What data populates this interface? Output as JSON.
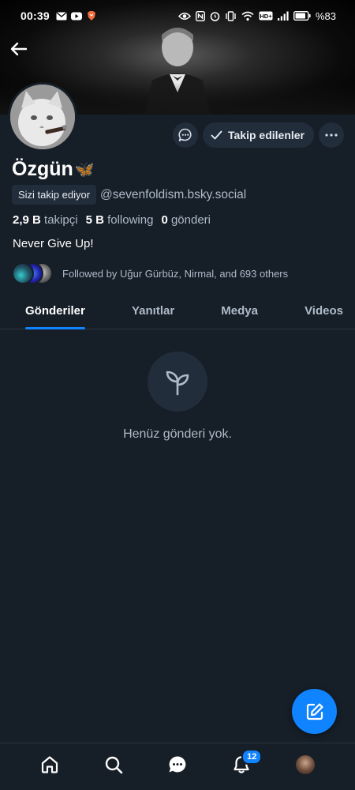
{
  "status_bar": {
    "time": "00:39",
    "battery_text": "%83",
    "network_badge": "HD+"
  },
  "profile": {
    "display_name": "Özgün",
    "name_emoji": "🦋",
    "follows_you_label": "Sizi takip ediyor",
    "handle": "@sevenfoldism.bsky.social",
    "followers_count": "2,9 B",
    "followers_label": "takipçi",
    "following_count": "5 B",
    "following_label": "following",
    "posts_count": "0",
    "posts_label": "gönderi",
    "bio": "Never Give Up!",
    "followed_by_text": "Followed by Uğur Gürbüz, Nirmal, and 693 others"
  },
  "actions": {
    "following_button_label": "Takip edilenler"
  },
  "tabs": [
    {
      "label": "Gönderiler",
      "active": true
    },
    {
      "label": "Yanıtlar",
      "active": false
    },
    {
      "label": "Medya",
      "active": false
    },
    {
      "label": "Videos",
      "active": false
    }
  ],
  "empty_state": {
    "message": "Henüz gönderi yok."
  },
  "bottom_nav": {
    "notifications_badge": "12"
  },
  "colors": {
    "background": "#161e27",
    "accent": "#1083fe",
    "secondary_text": "#aebbc9",
    "button_bg": "#222d3b"
  }
}
